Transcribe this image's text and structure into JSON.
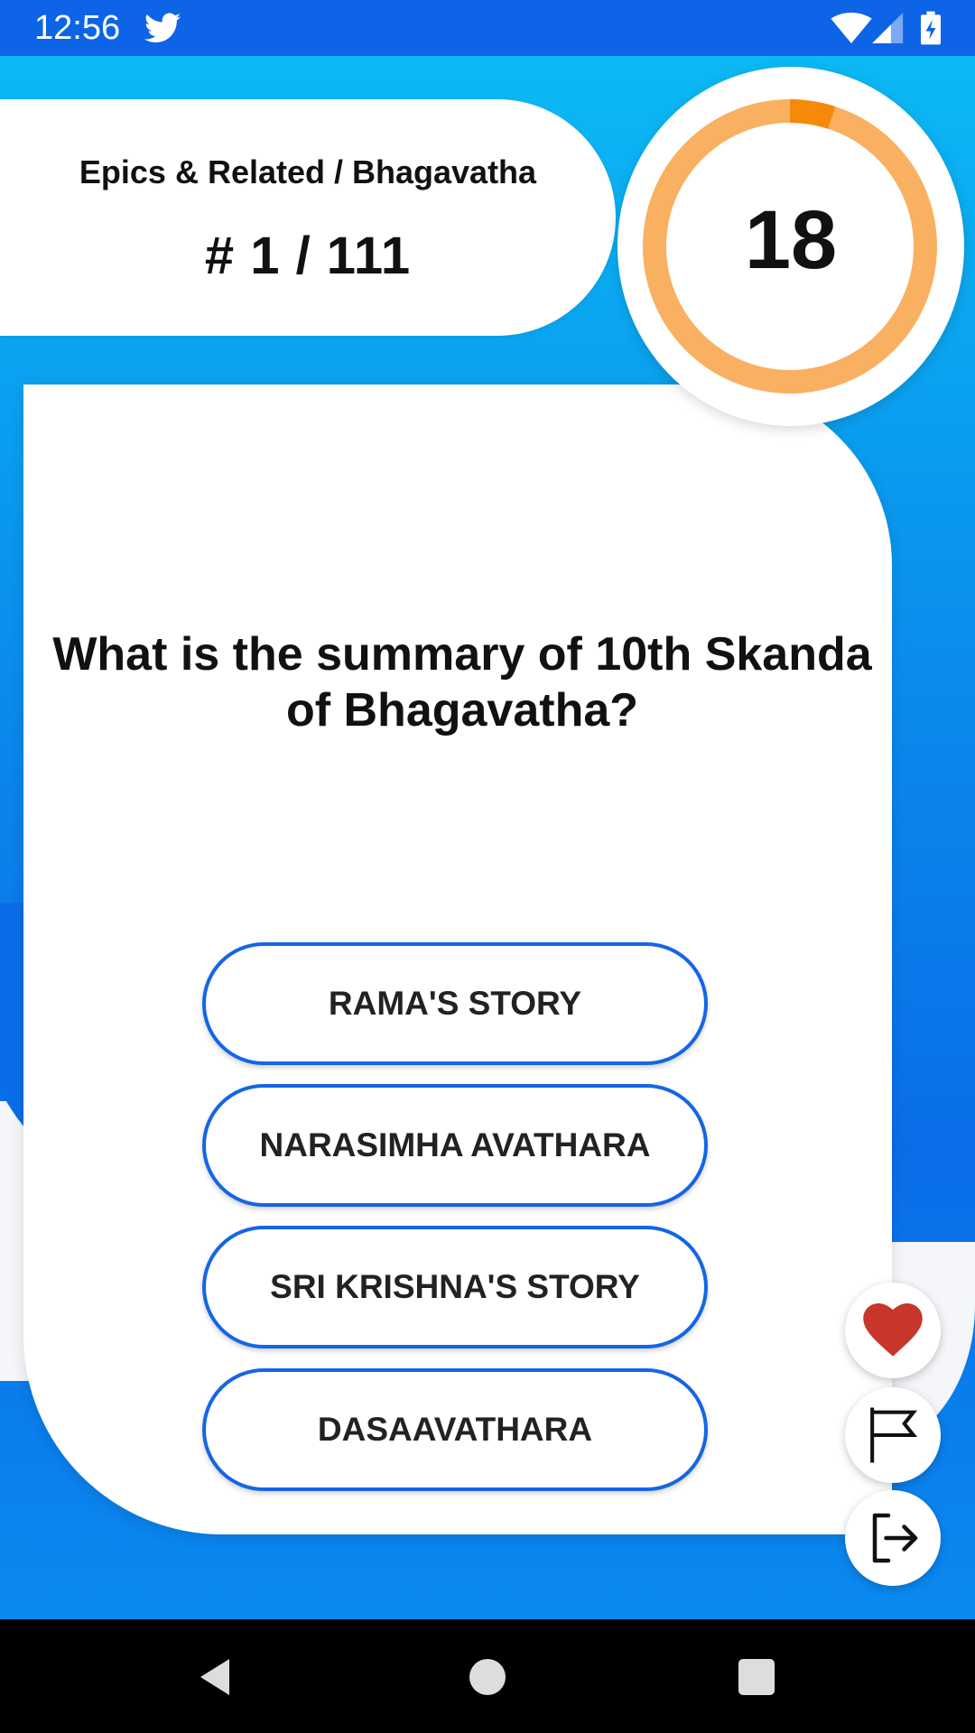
{
  "status_bar": {
    "time": "12:56",
    "icons": [
      "twitter-icon",
      "wifi-icon",
      "signal-icon",
      "battery-icon"
    ]
  },
  "header": {
    "category": "Epics & Related / Bhagavatha",
    "counter": "# 1 / 111"
  },
  "timer": {
    "value": "18",
    "progress_fraction": 0.05,
    "ring_color": "#f9b061",
    "progress_color": "#f58a0a"
  },
  "question": {
    "text": "What is the summary of 10th Skanda of Bhagavatha?"
  },
  "answers": [
    {
      "label": "RAMA'S STORY"
    },
    {
      "label": "NARASIMHA AVATHARA"
    },
    {
      "label": "SRI KRISHNA'S STORY"
    },
    {
      "label": "DASAAVATHARA"
    }
  ],
  "side_actions": [
    "heart-icon",
    "flag-icon",
    "exit-icon"
  ],
  "colors": {
    "accent_blue": "#1565e6",
    "background_blue": "#0a86ec",
    "heart_red": "#c8352b"
  },
  "nav": [
    "back-icon",
    "home-icon",
    "recents-icon"
  ]
}
